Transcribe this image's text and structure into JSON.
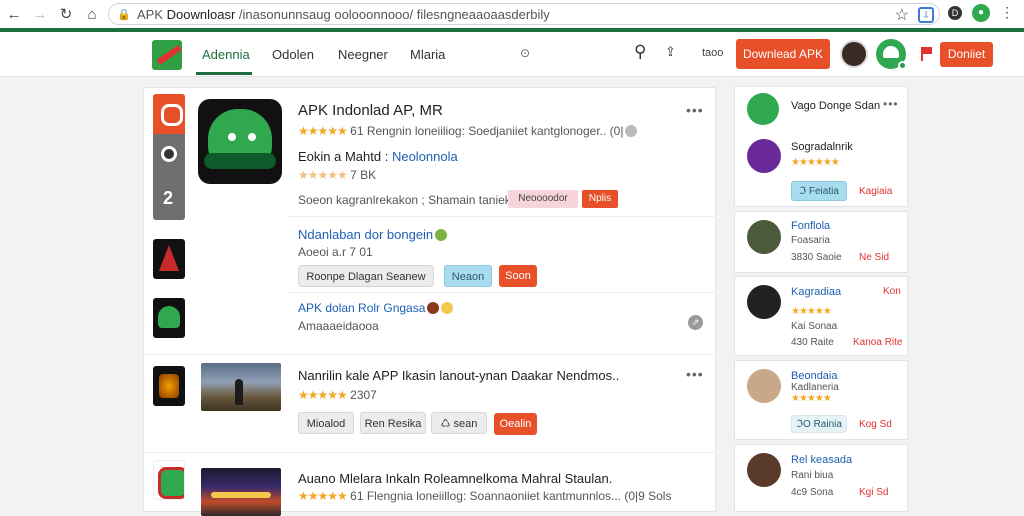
{
  "browser": {
    "url_prefix": "APK",
    "url_main": "Doownloasr",
    "url_rest": "/inasonunnsaug oolooonnooo/ filesngneaaoaasderbily",
    "ext_label": "D"
  },
  "header": {
    "nav": [
      "Adennia",
      "Odolen",
      "Neegner",
      "Mlaria"
    ],
    "small_text": "taoo",
    "download_label": "Downlead APK",
    "download2_label": "Doniiet"
  },
  "main": {
    "app1": {
      "title": "APK Indonlad AP, MR",
      "stars": "★★★★★",
      "meta": "61 Rengnin loneiiliog: Soedjaniiet kantglonoger.. (0|",
      "subtitle_prefix": "Eokin a Mahtd : ",
      "subtitle_link": "Neolonnola",
      "stars2": "★★★★★",
      "meta2": "7 BK",
      "desc": "Soeon kagranlrekakon ; Shamain tanieka:",
      "pill1": "Neoooodor",
      "pill2": "Nplis"
    },
    "app2": {
      "title": "Ndanlaban dor bongein",
      "meta": "Aoeoi a.r 7 01",
      "btn1": "Roonpe Dlagan Seanew",
      "btn2": "Neaon",
      "btn3": "Soon"
    },
    "app3": {
      "title": "APK dolan Rolr Gngasa",
      "meta": "Amaaaeidaooa"
    },
    "app4": {
      "title": "Nanrilin kale APP Ikasin lanout-ynan Daakar Nendmos..",
      "stars": "★★★★★",
      "meta": "2307",
      "btn1": "Mioalod",
      "btn2": "Ren  Resika",
      "btn3": "♺ sean",
      "btn4": "Oealin"
    },
    "app5": {
      "title": "Auano Mlelara Inkaln Roleamnelkoma Mahral Staulan.",
      "stars": "★★★★★",
      "meta": "61 Flengnia loneiillog: Soannaoniiet kantmunnlos... (0|9 Sols"
    }
  },
  "sidebar": {
    "card1": {
      "item1_title": "Vago Donge Sdan",
      "item2_title": "Sogradalnrik",
      "item2_stars": "★★★★★★",
      "btn1": "ℑ Feiatia",
      "btn2": "Kagiaia"
    },
    "card2": {
      "title": "Fonflola",
      "meta": "Foasaria",
      "meta2": "3830 Saoie",
      "red": "Ne Sid"
    },
    "card3": {
      "title": "Kagradiaa",
      "stars": "★★★★★",
      "meta": "Kai Sonaa",
      "meta2": "430 Raite",
      "red": "Kanoa Rite",
      "red2": "Kon"
    },
    "card4": {
      "title": "Beondaia",
      "meta": "Kadlaneria",
      "stars": "★★★★★",
      "btn": "ℑO Rainia",
      "red": "Kog Sd"
    },
    "card5": {
      "title": "Rel keasada",
      "meta": "Rani biua",
      "meta2": "4c9 Sona",
      "red": "Kgi Sd"
    }
  },
  "colors": {
    "brand_green": "#1e6e3e",
    "accent_orange": "#e8502a",
    "link_blue": "#1e5fb4",
    "star_gold": "#f5a623"
  }
}
